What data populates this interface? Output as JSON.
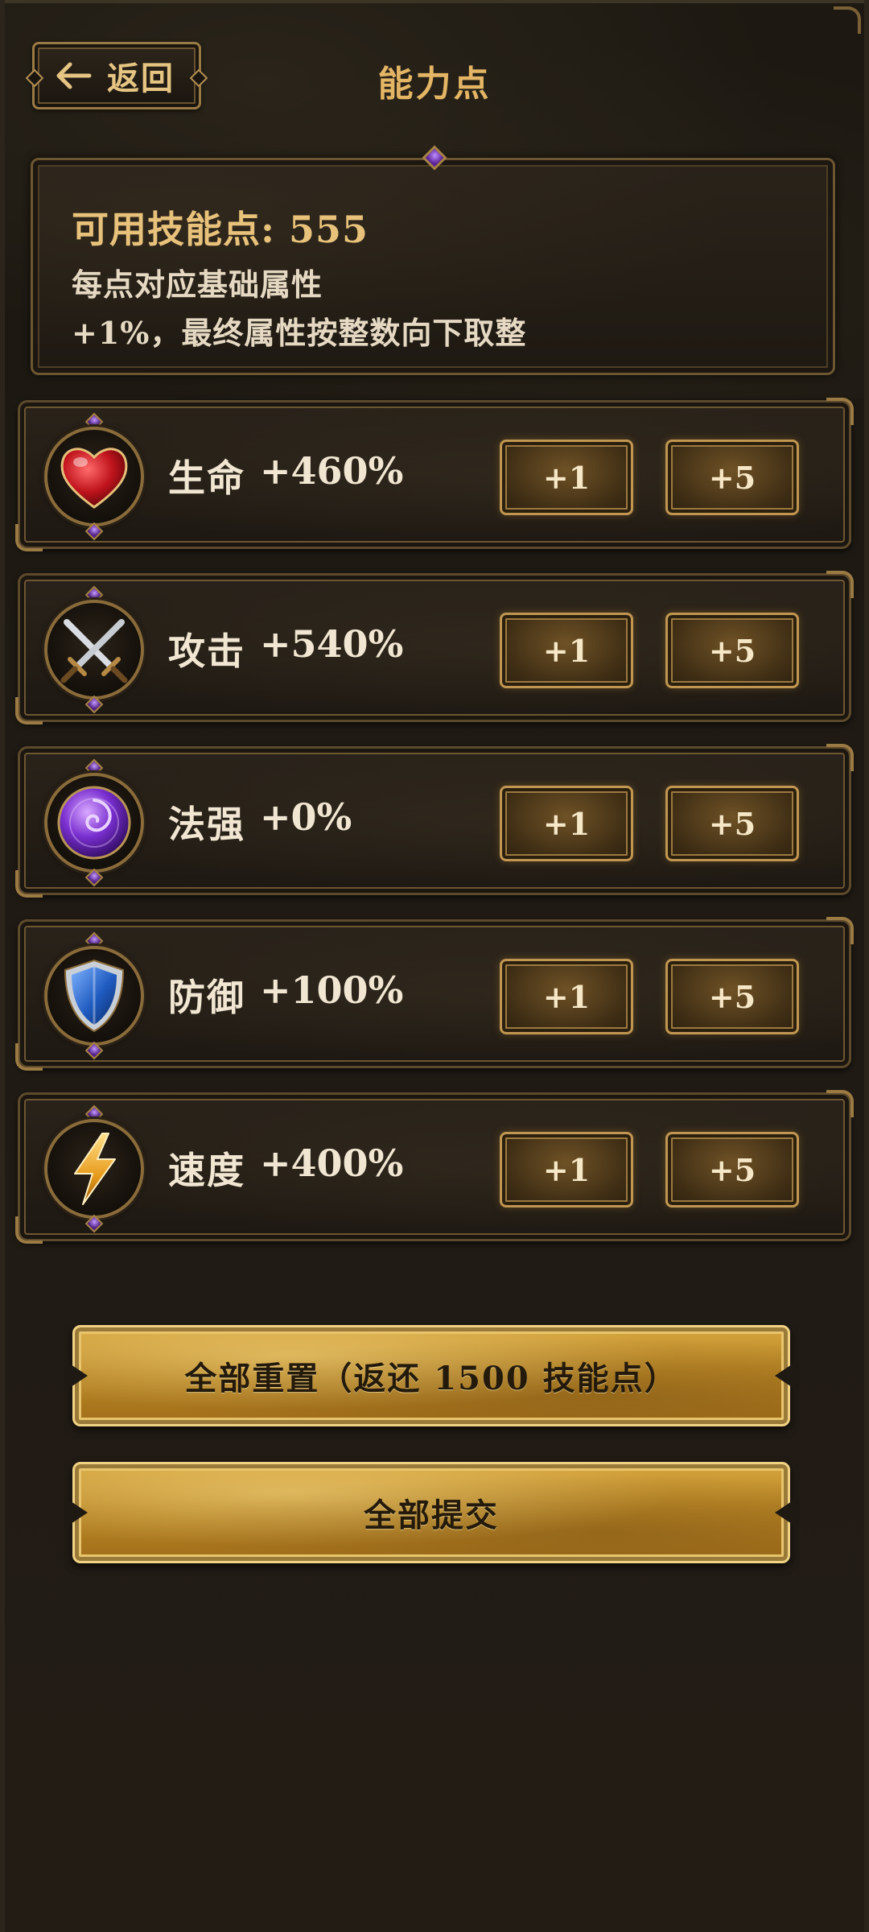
{
  "header": {
    "back_label": "返回",
    "title": "能力点"
  },
  "info": {
    "title": "可用技能点: 555",
    "line1": "每点对应基础属性",
    "line2": "+1%，最终属性按整数向下取整"
  },
  "stats": [
    {
      "name": "生命",
      "value": "+460%",
      "icon": "heart-icon",
      "plus_one": "+1",
      "plus_five": "+5"
    },
    {
      "name": "攻击",
      "value": "+540%",
      "icon": "crossed-swords-icon",
      "plus_one": "+1",
      "plus_five": "+5"
    },
    {
      "name": "法强",
      "value": "+0%",
      "icon": "magic-orb-icon",
      "plus_one": "+1",
      "plus_five": "+5"
    },
    {
      "name": "防御",
      "value": "+100%",
      "icon": "shield-icon",
      "plus_one": "+1",
      "plus_five": "+5"
    },
    {
      "name": "速度",
      "value": "+400%",
      "icon": "lightning-icon",
      "plus_one": "+1",
      "plus_five": "+5"
    }
  ],
  "actions": {
    "reset_label": "全部重置（返还 1500 技能点）",
    "submit_label": "全部提交"
  },
  "colors": {
    "accent_gold": "#e3b564",
    "panel_dark": "#1e1912",
    "text_light": "#f1e6d2"
  }
}
